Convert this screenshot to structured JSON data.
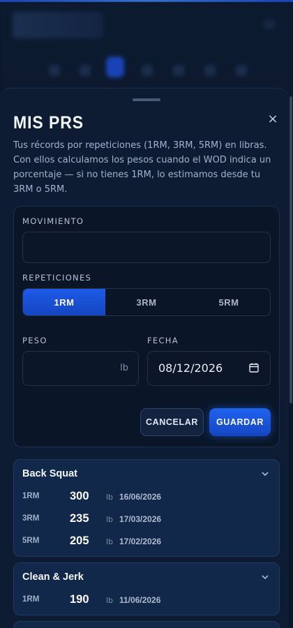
{
  "sheet": {
    "title": "MIS PRS",
    "description": "Tus récords por repeticiones (1RM, 3RM, 5RM) en libras. Con ellos calculamos los pesos cuando el WOD indica un porcentaje — si no tienes 1RM, lo estimamos desde tu 3RM o 5RM.",
    "close_icon": "×"
  },
  "form": {
    "movement_label": "MOVIMIENTO",
    "movement_value": "",
    "reps_label": "REPETICIONES",
    "reps_options": [
      "1RM",
      "3RM",
      "5RM"
    ],
    "reps_selected": "1RM",
    "weight_label": "PESO",
    "weight_value": "",
    "weight_unit": "lb",
    "date_label": "FECHA",
    "date_value": "08/12/2026",
    "cancel_label": "CANCELAR",
    "save_label": "GUARDAR"
  },
  "records": [
    {
      "name": "Back Squat",
      "entries": [
        {
          "rm": "1RM",
          "value": "300",
          "unit": "lb",
          "date": "16/06/2026"
        },
        {
          "rm": "3RM",
          "value": "235",
          "unit": "lb",
          "date": "17/03/2026"
        },
        {
          "rm": "5RM",
          "value": "205",
          "unit": "lb",
          "date": "17/02/2026"
        }
      ]
    },
    {
      "name": "Clean & Jerk",
      "entries": [
        {
          "rm": "1RM",
          "value": "190",
          "unit": "lb",
          "date": "11/06/2026"
        }
      ]
    }
  ],
  "colors": {
    "accent": "#1d5ae8",
    "background": "#0b1628",
    "card": "#12284a"
  }
}
